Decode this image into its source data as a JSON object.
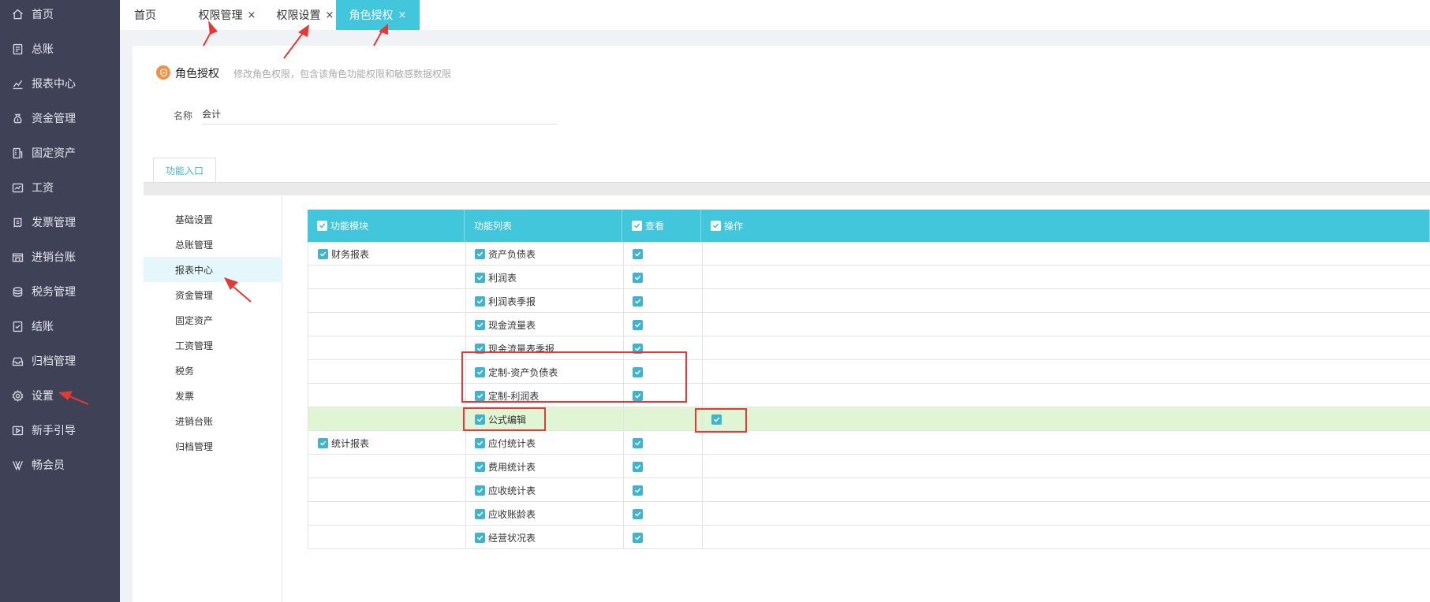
{
  "sidebar": {
    "items": [
      {
        "label": "首页",
        "icon": "home-icon"
      },
      {
        "label": "总账",
        "icon": "ledger-icon"
      },
      {
        "label": "报表中心",
        "icon": "chart-icon"
      },
      {
        "label": "资金管理",
        "icon": "money-bag-icon"
      },
      {
        "label": "固定资产",
        "icon": "building-icon"
      },
      {
        "label": "工资",
        "icon": "salary-icon"
      },
      {
        "label": "发票管理",
        "icon": "invoice-icon"
      },
      {
        "label": "进销台账",
        "icon": "store-icon"
      },
      {
        "label": "税务管理",
        "icon": "tax-icon"
      },
      {
        "label": "结账",
        "icon": "checkout-icon"
      },
      {
        "label": "归档管理",
        "icon": "archive-icon"
      },
      {
        "label": "设置",
        "icon": "gear-icon"
      },
      {
        "label": "新手引导",
        "icon": "guide-icon"
      },
      {
        "label": "畅会员",
        "icon": "vip-icon"
      }
    ]
  },
  "tabs": [
    {
      "label": "首页",
      "closable": false,
      "active": false
    },
    {
      "label": "权限管理",
      "closable": true,
      "active": false
    },
    {
      "label": "权限设置",
      "closable": true,
      "active": false
    },
    {
      "label": "角色授权",
      "closable": true,
      "active": true
    }
  ],
  "close_glyph": "×",
  "header": {
    "title": "角色授权",
    "description": "修改角色权限，包含该角色功能权限和敏感数据权限"
  },
  "name_field": {
    "label": "名称",
    "value": "会计"
  },
  "function_tab": {
    "label": "功能入口"
  },
  "modules": [
    {
      "label": "基础设置",
      "selected": false
    },
    {
      "label": "总账管理",
      "selected": false
    },
    {
      "label": "报表中心",
      "selected": true
    },
    {
      "label": "资金管理",
      "selected": false
    },
    {
      "label": "固定资产",
      "selected": false
    },
    {
      "label": "工资管理",
      "selected": false
    },
    {
      "label": "税务",
      "selected": false
    },
    {
      "label": "发票",
      "selected": false
    },
    {
      "label": "进销台账",
      "selected": false
    },
    {
      "label": "归档管理",
      "selected": false
    }
  ],
  "table": {
    "headers": {
      "module": "功能模块",
      "list": "功能列表",
      "view": "查看",
      "operate": "操作"
    },
    "rows": [
      {
        "module": "财务报表",
        "item": "资产负债表",
        "view": true,
        "operate": false,
        "highlight": false
      },
      {
        "module": "",
        "item": "利润表",
        "view": true,
        "operate": false,
        "highlight": false
      },
      {
        "module": "",
        "item": "利润表季报",
        "view": true,
        "operate": false,
        "highlight": false
      },
      {
        "module": "",
        "item": "现金流量表",
        "view": true,
        "operate": false,
        "highlight": false
      },
      {
        "module": "",
        "item": "现金流量表季报",
        "view": true,
        "operate": false,
        "highlight": false
      },
      {
        "module": "",
        "item": "定制-资产负债表",
        "view": true,
        "operate": false,
        "highlight": false
      },
      {
        "module": "",
        "item": "定制-利润表",
        "view": true,
        "operate": false,
        "highlight": false
      },
      {
        "module": "",
        "item": "公式编辑",
        "view": false,
        "operate": true,
        "highlight": true
      },
      {
        "module": "统计报表",
        "item": "应付统计表",
        "view": true,
        "operate": false,
        "highlight": false
      },
      {
        "module": "",
        "item": "费用统计表",
        "view": true,
        "operate": false,
        "highlight": false
      },
      {
        "module": "",
        "item": "应收统计表",
        "view": true,
        "operate": false,
        "highlight": false
      },
      {
        "module": "",
        "item": "应收账龄表",
        "view": true,
        "operate": false,
        "highlight": false
      },
      {
        "module": "",
        "item": "经营状况表",
        "view": true,
        "operate": false,
        "highlight": false
      }
    ]
  },
  "colors": {
    "accent": "#41c6dc",
    "sidebar_bg": "#3f4156",
    "highlight_row": "#dff5d3",
    "annotation_red": "#e53935"
  }
}
